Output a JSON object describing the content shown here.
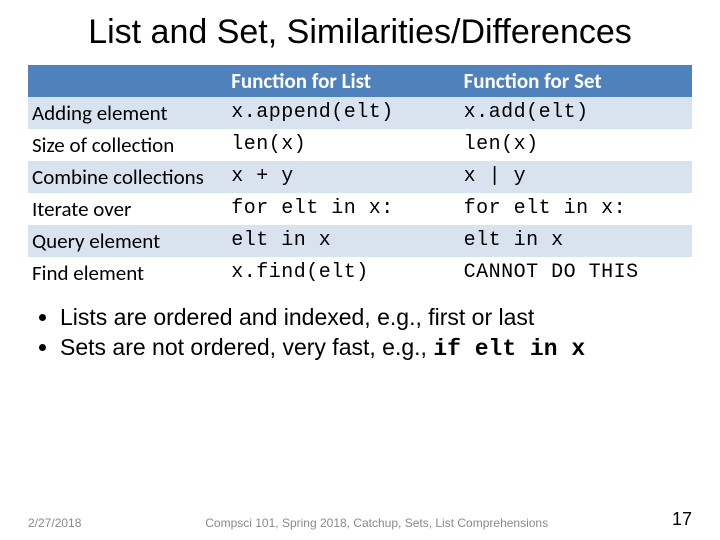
{
  "title": "List and Set, Similarities/Differences",
  "table": {
    "header": {
      "op": "",
      "list": "Function for List",
      "set": "Function for Set"
    },
    "rows": [
      {
        "op": "Adding element",
        "list": "x.append(elt)",
        "set": "x.add(elt)"
      },
      {
        "op": "Size of collection",
        "list": "len(x)",
        "set": "len(x)"
      },
      {
        "op": "Combine collections",
        "list": "x + y",
        "set": "x | y"
      },
      {
        "op": "Iterate over",
        "list": "for elt in x:",
        "set": "for elt in x:"
      },
      {
        "op": "Query element",
        "list": "elt in x",
        "set": "elt in x"
      },
      {
        "op": "Find element",
        "list": "x.find(elt)",
        "set": "CANNOT DO THIS"
      }
    ]
  },
  "bullets": [
    {
      "text": "Lists are ordered and indexed, e.g., first or last"
    },
    {
      "text": "Sets are not ordered, very fast, e.g., ",
      "code": "if elt in x"
    }
  ],
  "footer": {
    "date": "2/27/2018",
    "course": "Compsci 101, Spring 2018, Catchup, Sets, List Comprehensions",
    "page": "17"
  }
}
